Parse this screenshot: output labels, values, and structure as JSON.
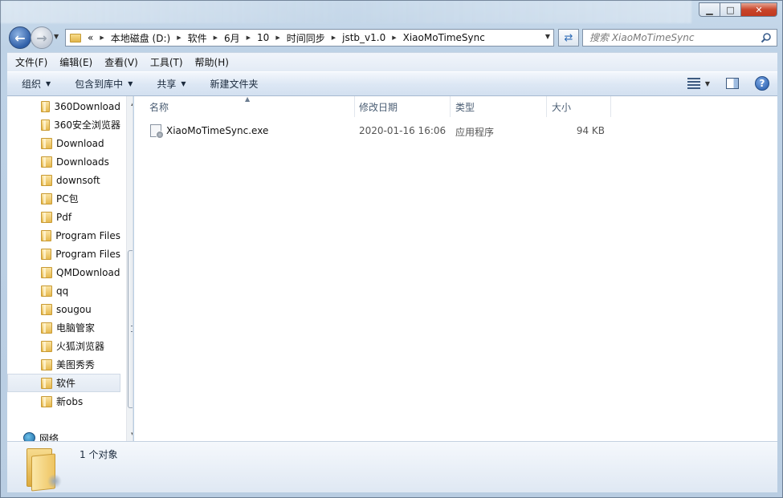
{
  "window": {
    "controls": {
      "minimize": "▁",
      "maximize": "□",
      "close": "✕"
    }
  },
  "nav": {
    "back_icon": "←",
    "forward_icon": "→",
    "overflow": "«",
    "breadcrumb": [
      "本地磁盘 (D:)",
      "软件",
      "6月",
      "10",
      "时间同步",
      "jstb_v1.0",
      "XiaoMoTimeSync"
    ],
    "refresh_icon": "⇄",
    "search_placeholder": "搜索 XiaoMoTimeSync"
  },
  "menubar": {
    "items": [
      "文件(F)",
      "编辑(E)",
      "查看(V)",
      "工具(T)",
      "帮助(H)"
    ]
  },
  "toolbar": {
    "organize": "组织",
    "include_in_library": "包含到库中",
    "share": "共享",
    "new_folder": "新建文件夹",
    "help": "?"
  },
  "sidebar": {
    "items": [
      {
        "label": "360Download"
      },
      {
        "label": "360安全浏览器"
      },
      {
        "label": "Download"
      },
      {
        "label": "Downloads"
      },
      {
        "label": "downsoft"
      },
      {
        "label": "PC包"
      },
      {
        "label": "Pdf"
      },
      {
        "label": "Program Files"
      },
      {
        "label": "Program Files"
      },
      {
        "label": "QMDownload"
      },
      {
        "label": "qq"
      },
      {
        "label": "sougou"
      },
      {
        "label": "电脑管家"
      },
      {
        "label": "火狐浏览器"
      },
      {
        "label": "美图秀秀"
      },
      {
        "label": "软件",
        "selected": true
      },
      {
        "label": "新obs"
      }
    ],
    "network_label": "网络"
  },
  "columns": {
    "name": "名称",
    "date": "修改日期",
    "type": "类型",
    "size": "大小"
  },
  "files": [
    {
      "name": "XiaoMoTimeSync.exe",
      "date": "2020-01-16 16:06",
      "type": "应用程序",
      "size": "94 KB"
    }
  ],
  "details": {
    "text": "1 个对象"
  }
}
